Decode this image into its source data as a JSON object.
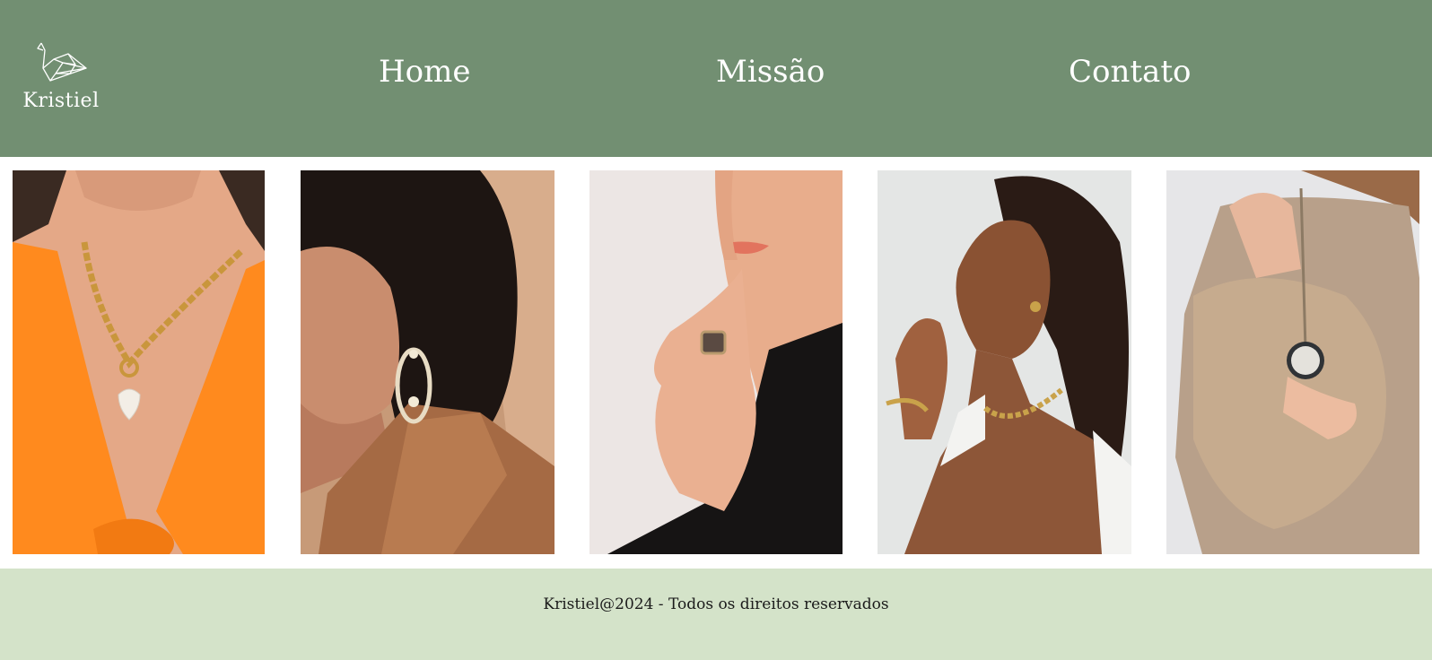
{
  "colors": {
    "header_bg": "#728f72",
    "footer_bg": "#d4e3c9",
    "nav_text": "#ffffff",
    "footer_text": "#1b1b1b"
  },
  "header": {
    "logo": {
      "icon": "origami-crane-icon",
      "text": "Kristiel"
    },
    "nav": [
      {
        "label": "Home"
      },
      {
        "label": "Missão"
      },
      {
        "label": "Contato"
      }
    ]
  },
  "gallery": {
    "photos": [
      {
        "subject": "gold chain necklace with crystal heart pendant on woman in orange top"
      },
      {
        "subject": "crystal chandelier earring on dark-haired woman"
      },
      {
        "subject": "cocktail ring on hand touching chin"
      },
      {
        "subject": "gold chain necklace, stud earring and bracelet"
      },
      {
        "subject": "vintage pocket watch held by woman in gold sequin dress"
      }
    ]
  },
  "footer": {
    "text": "Kristiel@2024 - Todos os direitos reservados"
  }
}
